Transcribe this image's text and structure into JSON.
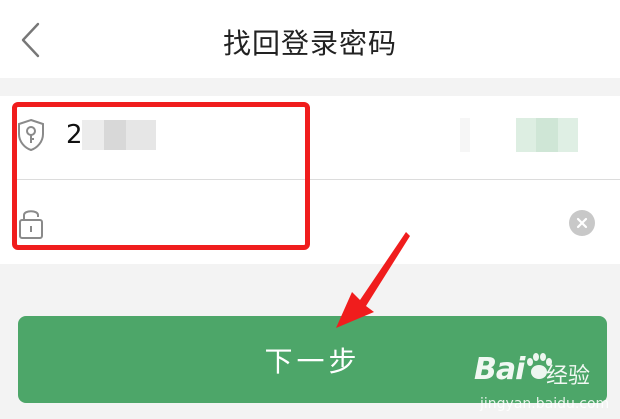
{
  "header": {
    "title": "找回登录密码",
    "back_icon": "chevron-left-icon"
  },
  "form": {
    "account": {
      "icon": "shield-key-icon",
      "value": "2"
    },
    "password": {
      "icon": "lock-icon",
      "value": "",
      "clear_icon": "clear-circle-icon"
    }
  },
  "next_button": {
    "label": "下一步"
  },
  "watermark": {
    "logo": "Bai",
    "text": "经验",
    "url": "jingyan.baidu.com"
  },
  "colors": {
    "primary_green": "#4da669",
    "annotation_red": "#f01d1d",
    "background": "#f3f3f3"
  }
}
